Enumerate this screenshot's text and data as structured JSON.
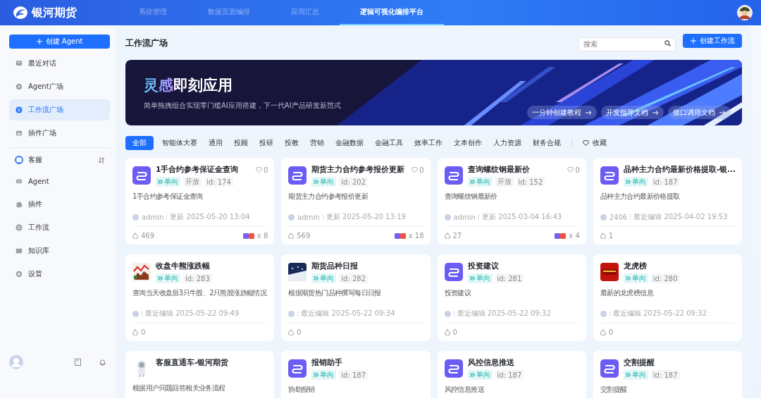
{
  "header": {
    "logo": "银河期货",
    "nav": [
      {
        "label": "系统管理",
        "selected": false
      },
      {
        "label": "数据页面编排",
        "selected": false
      },
      {
        "label": "应用汇总",
        "selected": false
      },
      {
        "label": "逻辑可视化编排平台",
        "selected": true
      }
    ]
  },
  "sidebar": {
    "create_button": "创建 Agent",
    "top_items": [
      {
        "label": "最近对话",
        "selected": false
      },
      {
        "label": "Agent广场",
        "selected": false
      },
      {
        "label": "工作流广场",
        "selected": true
      },
      {
        "label": "插件广场",
        "selected": false
      }
    ],
    "group": {
      "label": "客服",
      "items": [
        {
          "label": "Agent",
          "selected": false
        },
        {
          "label": "插件",
          "selected": false
        },
        {
          "label": "工作流",
          "selected": false
        },
        {
          "label": "知识库",
          "selected": false
        },
        {
          "label": "设置",
          "selected": false
        }
      ]
    }
  },
  "main": {
    "title": "工作流广场",
    "search": {
      "placeholder": "搜索"
    },
    "create_button": "创建工作流",
    "banner": {
      "title_accent": "灵感",
      "title_rest": "即刻应用",
      "subtitle": "简单拖拽组合实现零门槛AI应用搭建，下一代AI产品研发新范式",
      "links": [
        "一分钟创建教程",
        "开发指导文档",
        "接口调用文档"
      ]
    },
    "filters": [
      {
        "label": "全部",
        "selected": true
      },
      {
        "label": "智能体大赛",
        "selected": false
      },
      {
        "label": "通用",
        "selected": false
      },
      {
        "label": "投顾",
        "selected": false
      },
      {
        "label": "投研",
        "selected": false
      },
      {
        "label": "投教",
        "selected": false
      },
      {
        "label": "营销",
        "selected": false
      },
      {
        "label": "金融数据",
        "selected": false
      },
      {
        "label": "金融工具",
        "selected": false
      },
      {
        "label": "效率工作",
        "selected": false
      },
      {
        "label": "文本创作",
        "selected": false
      },
      {
        "label": "人力资源",
        "selected": false
      },
      {
        "label": "财务合规",
        "selected": false
      }
    ],
    "favorites": "收藏",
    "cards": [
      {
        "kind": "workflow",
        "title": "1手合约参考保证金查询",
        "likes": "0",
        "tags": [
          {
            "kind": "direction",
            "text": "单向"
          },
          {
            "kind": "plain",
            "text": "开放"
          },
          {
            "kind": "plain",
            "text": "id: 174"
          }
        ],
        "description": "1手合约参考保证金查询",
        "author": "admin",
        "updated": "更新 2025-05-20 13:04",
        "uses": "469",
        "calls": "x 8"
      },
      {
        "kind": "workflow",
        "title": "期货主力合约参考报价更新",
        "likes": "0",
        "tags": [
          {
            "kind": "direction",
            "text": "单向"
          },
          {
            "kind": "plain",
            "text": "id: 202"
          }
        ],
        "description": "期货主力合约参考报价更新",
        "author": "admin",
        "updated": "更新 2025-05-20 13:19",
        "uses": "569",
        "calls": "x 18"
      },
      {
        "kind": "workflow",
        "title": "查询螺纹钢最新价",
        "likes": "0",
        "tags": [
          {
            "kind": "direction",
            "text": "单向"
          },
          {
            "kind": "plain",
            "text": "开放"
          },
          {
            "kind": "plain",
            "text": "id: 152"
          }
        ],
        "description": "查询螺纹钢最新价",
        "author": "admin",
        "updated": "更新 2025-03-04 16:43",
        "uses": "27",
        "calls": "x 4"
      },
      {
        "kind": "workflow",
        "title": "品种主力合约最新价格提取-银...",
        "tags": [
          {
            "kind": "direction",
            "text": "单向"
          },
          {
            "kind": "plain",
            "text": "id: 187"
          }
        ],
        "description": "品种主力合约最新价格提取",
        "author": "2406",
        "updated": "最近编辑 2025-04-02 19:53",
        "uses": "1"
      },
      {
        "kind": "chart",
        "title": "收盘牛熊涨跌幅",
        "tags": [
          {
            "kind": "direction",
            "text": "单向"
          },
          {
            "kind": "plain",
            "text": "id: 283"
          }
        ],
        "description": "查询当天收盘后3只牛股、2只熊股涨跌幅情况",
        "updated": "最近编辑 2025-05-22 09:49",
        "uses": "0"
      },
      {
        "kind": "picture",
        "title": "期货品种日报",
        "tags": [
          {
            "kind": "direction",
            "text": "单向"
          },
          {
            "kind": "plain",
            "text": "id: 282"
          }
        ],
        "description": "根据期货热门品种撰写每日日报",
        "updated": "最近编辑 2025-05-22 09:34",
        "uses": "0"
      },
      {
        "kind": "workflow",
        "title": "投资建议",
        "tags": [
          {
            "kind": "direction",
            "text": "单向"
          },
          {
            "kind": "plain",
            "text": "id: 281"
          }
        ],
        "description": "投资建议",
        "updated": "最近编辑 2025-05-22 09:32",
        "uses": "0"
      },
      {
        "kind": "red",
        "title": "龙虎榜",
        "tags": [
          {
            "kind": "direction",
            "text": "单向"
          },
          {
            "kind": "plain",
            "text": "id: 280"
          }
        ],
        "description": "最新的龙虎榜信息",
        "updated": "最近编辑 2025-05-22 09:32",
        "uses": "0"
      },
      {
        "kind": "robot",
        "title": "客服直通车-银河期货",
        "description": "根据用户问题回答相关业务流程"
      },
      {
        "kind": "workflow",
        "title": "报销助手",
        "tags": [
          {
            "kind": "direction",
            "text": "单向"
          },
          {
            "kind": "plain",
            "text": "id: 187"
          }
        ],
        "description": "协助报销"
      },
      {
        "kind": "workflow",
        "title": "风控信息推送",
        "tags": [
          {
            "kind": "direction",
            "text": "单向"
          },
          {
            "kind": "plain",
            "text": "id: 187"
          }
        ],
        "description": "风控信息推送"
      },
      {
        "kind": "workflow",
        "title": "交割提醒",
        "tags": [
          {
            "kind": "direction",
            "text": "单向"
          },
          {
            "kind": "plain",
            "text": "id: 187"
          }
        ],
        "description": "交割提醒"
      }
    ]
  }
}
